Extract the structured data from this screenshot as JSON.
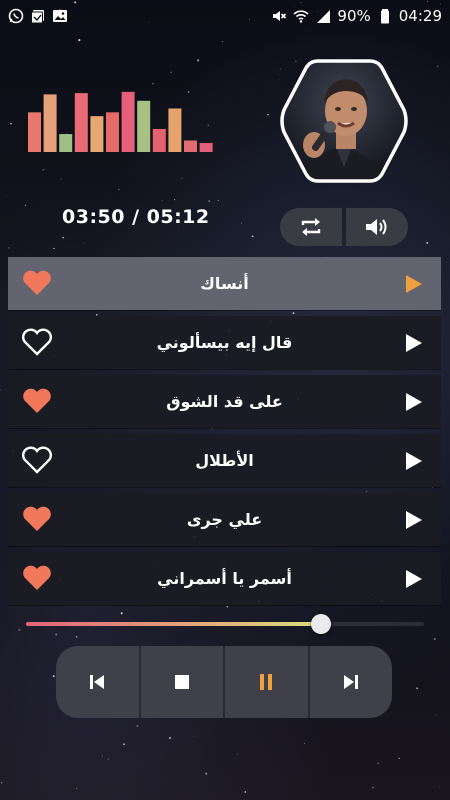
{
  "status_bar": {
    "battery_percent": "90%",
    "clock": "04:29",
    "left_icons": [
      "whatsapp-icon",
      "photo-gallery-icon",
      "image-icon"
    ],
    "right_icons": [
      "mute-icon",
      "wifi-icon",
      "signal-icon",
      "battery-icon"
    ]
  },
  "player": {
    "time_display": "03:50 / 05:12",
    "progress_fraction": 0.74,
    "equalizer_levels": [
      0.62,
      0.9,
      0.28,
      0.92,
      0.56,
      0.62,
      0.94,
      0.8,
      0.36,
      0.68,
      0.18,
      0.14
    ],
    "equalizer_colors": [
      "#e8776d",
      "#e6a07a",
      "#9fbf86",
      "#e86b76",
      "#e6a873",
      "#e56a6a",
      "#e6607a",
      "#a7c185",
      "#e4616e",
      "#e7a36e",
      "#e36c72",
      "#e0607a"
    ],
    "accent_color": "#f0a03c"
  },
  "controls": {
    "repeat_icon": "repeat-icon",
    "volume_icon": "volume-icon"
  },
  "playlist": [
    {
      "title": "أنساك",
      "favorite": true,
      "active": true
    },
    {
      "title": "قال إيه بيسألوني",
      "favorite": false,
      "active": false
    },
    {
      "title": "على قد الشوق",
      "favorite": true,
      "active": false
    },
    {
      "title": "الأطلال",
      "favorite": false,
      "active": false
    },
    {
      "title": "علي جرى",
      "favorite": true,
      "active": false
    },
    {
      "title": "أسمر يا أسمراني",
      "favorite": true,
      "active": false
    }
  ],
  "transport": {
    "buttons": [
      "previous-icon",
      "stop-icon",
      "pause-icon",
      "next-icon"
    ]
  },
  "colors": {
    "heart_fill": "#f2785c",
    "heart_outline": "#ffffff",
    "active_row": "#626470",
    "row": "#1a1b23"
  }
}
